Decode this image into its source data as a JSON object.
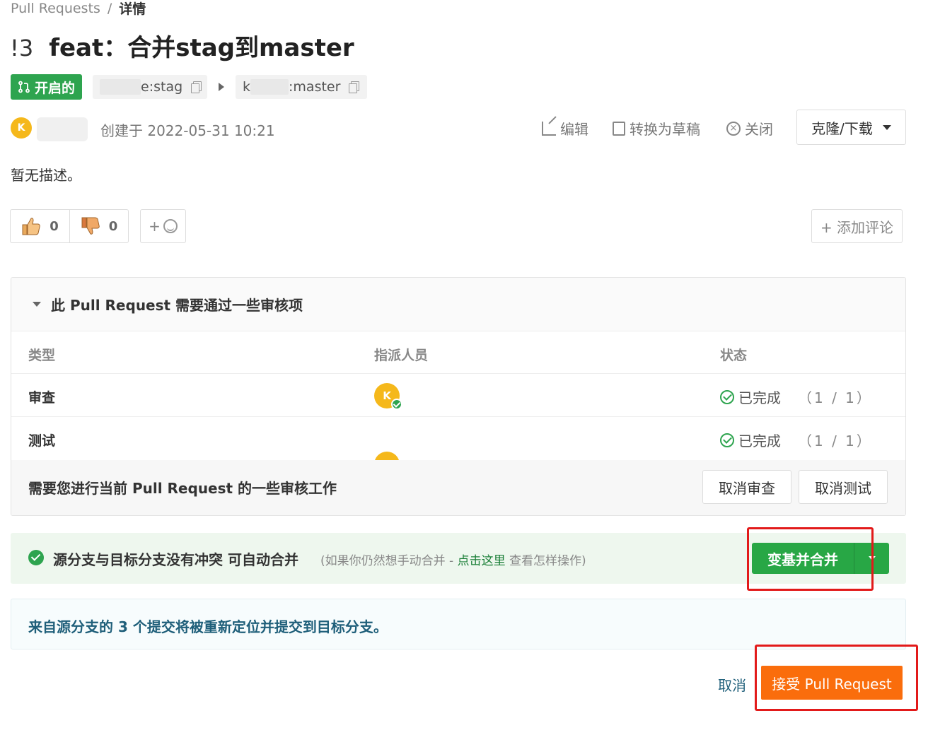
{
  "breadcrumb": {
    "root": "Pull Requests",
    "separator": "/",
    "current": "详情"
  },
  "pr": {
    "number": "!3",
    "title": "feat：合并stag到master",
    "status": "开启的"
  },
  "branches": {
    "source_suffix": "e:stag",
    "target_prefix": "k",
    "target_suffix": ":master"
  },
  "author": {
    "avatar_letter": "K",
    "created": "创建于 2022-05-31 10:21"
  },
  "actions": {
    "edit": "编辑",
    "to_draft": "转换为草稿",
    "close": "关闭",
    "clone": "克隆/下载"
  },
  "description": "暂无描述。",
  "reactions": {
    "like_count": "0",
    "dislike_count": "0",
    "emoji_plus": "+",
    "add_comment": "+ 添加评论"
  },
  "review": {
    "heading": "此 Pull Request 需要通过一些审核项",
    "columns": {
      "type": "类型",
      "assignee": "指派人员",
      "status": "状态"
    },
    "rows": [
      {
        "type": "审查",
        "assignee_letter": "K",
        "status": "已完成",
        "count": "（1 / 1）"
      },
      {
        "type": "测试",
        "assignee_letter": "K",
        "status": "已完成",
        "count": "（1 / 1）"
      }
    ],
    "work_text": "需要您进行当前 Pull Request 的一些审核工作",
    "cancel_review": "取消审查",
    "cancel_test": "取消测试"
  },
  "merge": {
    "message": "源分支与目标分支没有冲突 可自动合并",
    "hint_prefix": "(如果你仍然想手动合并 - ",
    "hint_link": "点击这里",
    "hint_suffix": " 查看怎样操作)",
    "button": "变基并合并"
  },
  "info": "来自源分支的 3 个提交将被重新定位并提交到目标分支。",
  "footer": {
    "cancel": "取消",
    "accept": "接受 Pull Request"
  },
  "colors": {
    "green": "#2ea44f",
    "orange": "#fa6d0c",
    "highlight": "#e21a1a",
    "avatar": "#f5b81b"
  }
}
